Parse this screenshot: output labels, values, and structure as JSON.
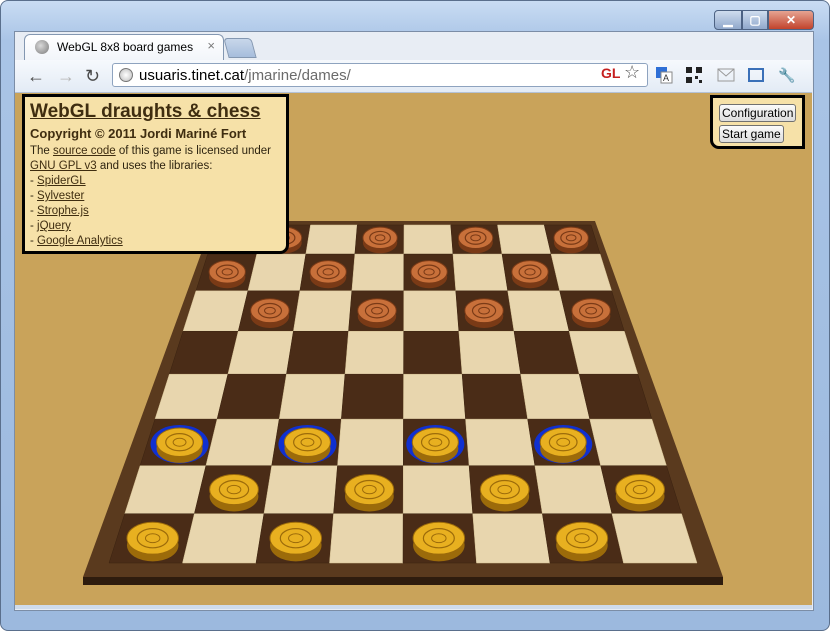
{
  "browser": {
    "tab_title": "WebGL 8x8 board games",
    "tab_close": "×",
    "url_host": "usuaris.tinet.cat",
    "url_path": "/jmarine/dames/",
    "gl_badge": "GL",
    "back_icon": "back-arrow-icon",
    "forward_icon": "forward-arrow-icon",
    "reload_icon": "reload-icon",
    "star_icon": "bookmark-star-icon",
    "extensions": [
      "translate-icon",
      "qr-code-icon",
      "mail-icon",
      "fullscreen-icon",
      "wrench-icon"
    ]
  },
  "window_controls": {
    "minimize": "minimize-icon",
    "maximize": "maximize-icon",
    "close": "close-icon"
  },
  "info_panel": {
    "title": "WebGL draughts & chess",
    "copyright": "Copyright © 2011 Jordi Mariné Fort",
    "text_1": "The ",
    "source_code_link": "source code",
    "text_2": " of this game is licensed under ",
    "license_link": "GNU GPL v3",
    "text_3": " and uses the libraries:",
    "libraries": [
      "SpiderGL",
      "Sylvester",
      "Strophe.js",
      "jQuery",
      "Google Analytics"
    ]
  },
  "controls": {
    "configuration_label": "Configuration",
    "start_game_label": "Start game"
  },
  "board": {
    "rows": 8,
    "cols": 8,
    "colors": {
      "background": "#c9a35a",
      "frame": "#5a3a1e",
      "dark_square": "#4a2c17",
      "light_square": "#e8d6ae",
      "copper_piece": "#c8703a",
      "gold_piece": "#e8b020",
      "selectable_ring": "#1030d0"
    },
    "pieces": [
      {
        "row": 0,
        "col": 1,
        "color": "copper"
      },
      {
        "row": 0,
        "col": 3,
        "color": "copper"
      },
      {
        "row": 0,
        "col": 5,
        "color": "copper"
      },
      {
        "row": 0,
        "col": 7,
        "color": "copper"
      },
      {
        "row": 1,
        "col": 0,
        "color": "copper"
      },
      {
        "row": 1,
        "col": 2,
        "color": "copper"
      },
      {
        "row": 1,
        "col": 4,
        "color": "copper"
      },
      {
        "row": 1,
        "col": 6,
        "color": "copper"
      },
      {
        "row": 2,
        "col": 1,
        "color": "copper"
      },
      {
        "row": 2,
        "col": 3,
        "color": "copper"
      },
      {
        "row": 2,
        "col": 5,
        "color": "copper"
      },
      {
        "row": 2,
        "col": 7,
        "color": "copper"
      },
      {
        "row": 5,
        "col": 0,
        "color": "gold",
        "selectable": true
      },
      {
        "row": 5,
        "col": 2,
        "color": "gold",
        "selectable": true
      },
      {
        "row": 5,
        "col": 4,
        "color": "gold",
        "selectable": true
      },
      {
        "row": 5,
        "col": 6,
        "color": "gold",
        "selectable": true
      },
      {
        "row": 6,
        "col": 1,
        "color": "gold"
      },
      {
        "row": 6,
        "col": 3,
        "color": "gold"
      },
      {
        "row": 6,
        "col": 5,
        "color": "gold"
      },
      {
        "row": 6,
        "col": 7,
        "color": "gold"
      },
      {
        "row": 7,
        "col": 0,
        "color": "gold"
      },
      {
        "row": 7,
        "col": 2,
        "color": "gold"
      },
      {
        "row": 7,
        "col": 4,
        "color": "gold"
      },
      {
        "row": 7,
        "col": 6,
        "color": "gold"
      }
    ]
  }
}
